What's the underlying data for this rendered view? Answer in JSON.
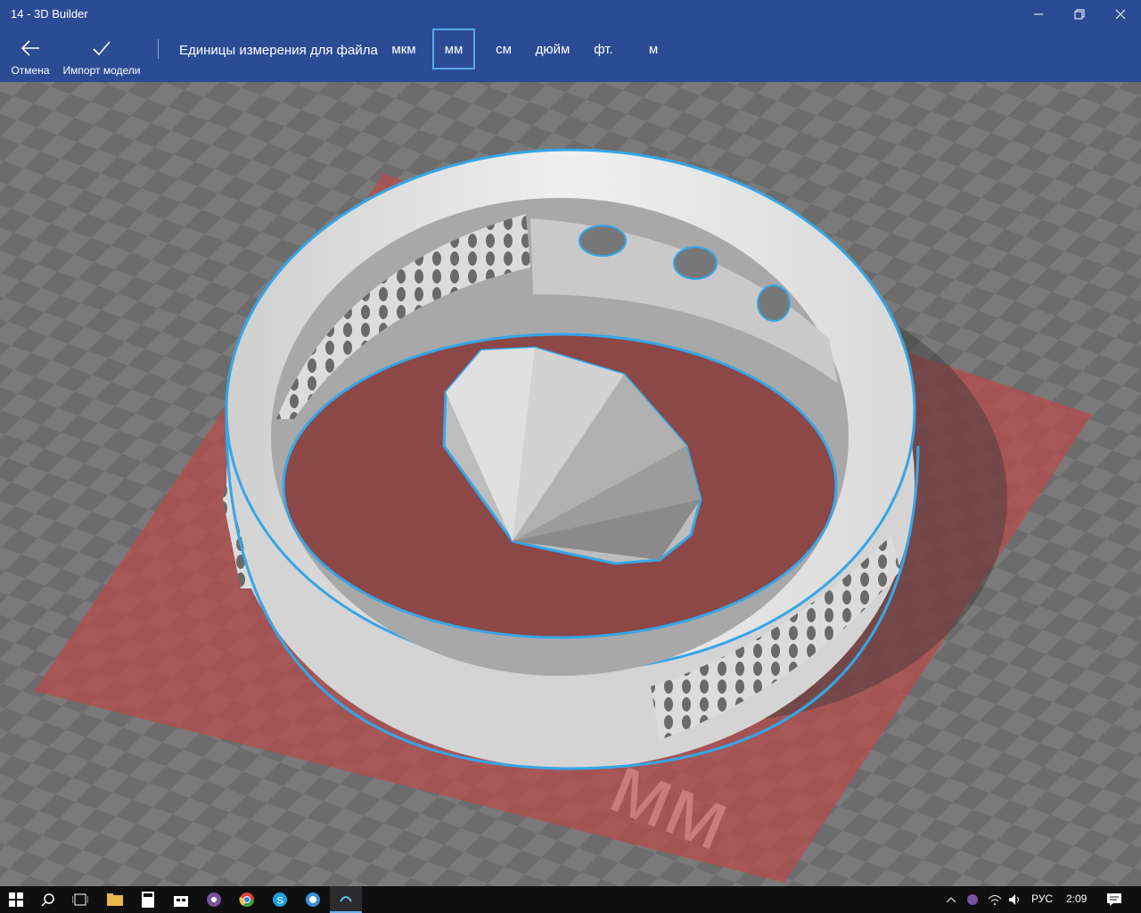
{
  "window": {
    "title": "14 - 3D Builder",
    "minimize": "—",
    "restore": "❐",
    "close": "✕"
  },
  "toolbar": {
    "cancel_label": "Отмена",
    "import_label": "Импорт модели",
    "units_label": "Единицы измерения для файла",
    "units": [
      "мкм",
      "мм",
      "см",
      "дюйм",
      "фт.",
      "м"
    ],
    "selected_unit": "мм"
  },
  "viewport": {
    "floor_label": "мм",
    "accent_color": "#35a6e8",
    "plate_color": "#b84a4a"
  },
  "taskbar": {
    "language": "РУС",
    "time": "2:09"
  }
}
